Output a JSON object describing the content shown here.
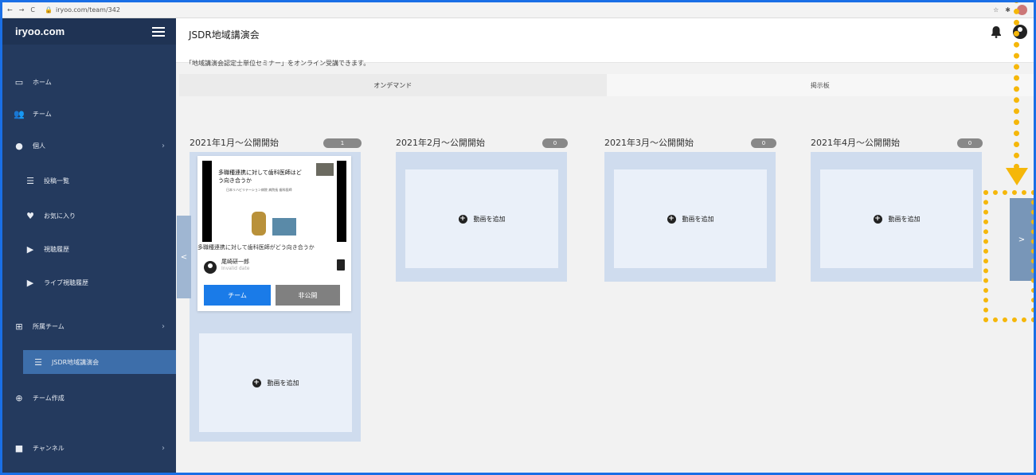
{
  "browser": {
    "url": "iryoo.com/team/342"
  },
  "sidebar": {
    "brand": "iryoo.com",
    "items": [
      {
        "label": "ホーム",
        "icon": "monitor-icon"
      },
      {
        "label": "チーム",
        "icon": "users-icon"
      },
      {
        "label": "個人",
        "icon": "user-icon"
      },
      {
        "label": "投稿一覧",
        "icon": "list-icon"
      },
      {
        "label": "お気に入り",
        "icon": "heart-icon"
      },
      {
        "label": "視聴履歴",
        "icon": "play-icon"
      },
      {
        "label": "ライブ視聴履歴",
        "icon": "play-icon"
      },
      {
        "label": "所属チーム",
        "icon": "sitemap-icon"
      },
      {
        "label": "JSDR地域講演会",
        "icon": "list-icon"
      },
      {
        "label": "チーム作成",
        "icon": "plus-circle-icon"
      },
      {
        "label": "チャンネル",
        "icon": "video-icon"
      }
    ]
  },
  "header": {
    "title": "JSDR地域講演会"
  },
  "info_text": "「地域講演会認定士単位セミナー」をオンライン受講できます。",
  "tabs": [
    {
      "label": "オンデマンド"
    },
    {
      "label": "掲示板"
    }
  ],
  "columns": [
    {
      "title": "2021年1月〜公開開始",
      "count": "1"
    },
    {
      "title": "2021年2月〜公開開始",
      "count": "0"
    },
    {
      "title": "2021年3月〜公開開始",
      "count": "0"
    },
    {
      "title": "2021年4月〜公開開始",
      "count": "0"
    }
  ],
  "add_video_label": "動画を追加",
  "card": {
    "thumb_title": "多職種連携に対して歯科医師はどう向き合うか",
    "thumb_small": "日本リハビリテーション病院 病院長 歯科医師",
    "title": "多職種連携に対して歯科医師がどう向き合うか",
    "author": "尾崎研一郎",
    "date": "Invalid date",
    "team_button": "チーム",
    "private_button": "非公開"
  },
  "pager": {
    "prev": "<",
    "next": ">"
  },
  "colors": {
    "sidebar": "#243a5e",
    "accent": "#1a7be8",
    "highlight": "#f5b70a"
  }
}
